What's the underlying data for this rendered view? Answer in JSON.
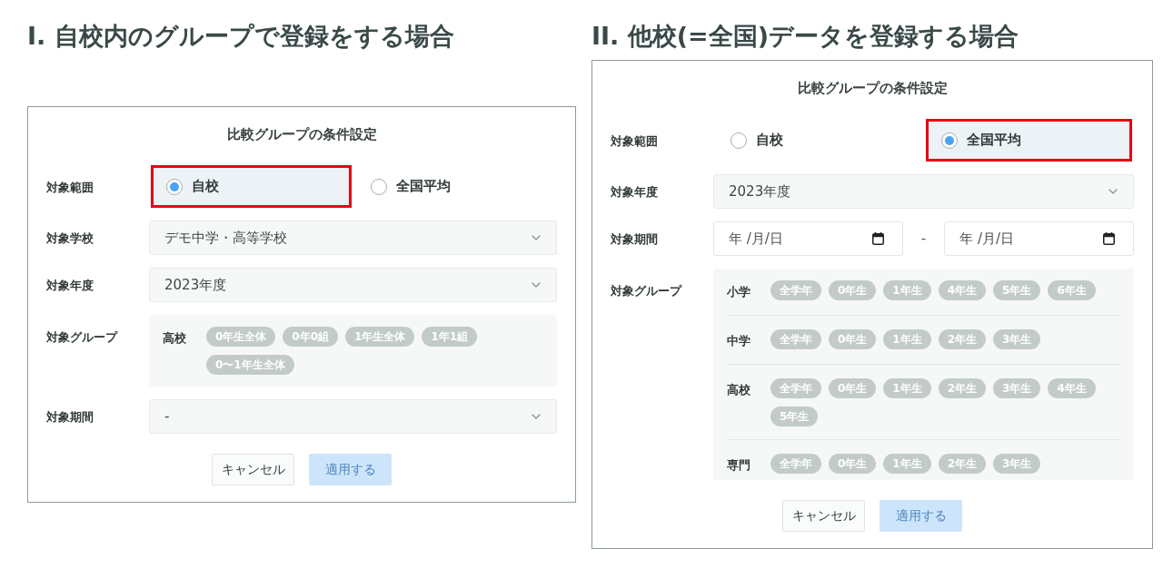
{
  "sections": [
    {
      "heading": "I. 自校内のグループで登録をする場合",
      "dialog": {
        "title": "比較グループの条件設定",
        "rows": [
          {
            "kind": "radio",
            "label": "対象範囲",
            "options": [
              {
                "label": "自校",
                "selected": true,
                "highlighted": true
              },
              {
                "label": "全国平均",
                "selected": false,
                "highlighted": false
              }
            ]
          },
          {
            "kind": "select",
            "label": "対象学校",
            "value": "デモ中学・高等学校"
          },
          {
            "kind": "select",
            "label": "対象年度",
            "value": "2023年度"
          },
          {
            "kind": "groups",
            "label": "対象グループ",
            "groups": [
              {
                "name": "高校",
                "chips": [
                  {
                    "label": "0年生全体",
                    "selected": false
                  },
                  {
                    "label": "0年0組",
                    "selected": false
                  },
                  {
                    "label": "1年生全体",
                    "selected": false
                  },
                  {
                    "label": "1年1組",
                    "selected": false
                  },
                  {
                    "label": "0〜1年生全体",
                    "selected": false
                  }
                ]
              }
            ]
          },
          {
            "kind": "select",
            "label": "対象期間",
            "value": "-"
          }
        ],
        "buttons": [
          {
            "kind": "secondary",
            "label": "キャンセル",
            "disabled": false
          },
          {
            "kind": "primary",
            "label": "適用する",
            "disabled": true
          }
        ]
      }
    },
    {
      "heading": "II. 他校(=全国)データを登録する場合",
      "dialog": {
        "title": "比較グループの条件設定",
        "rows": [
          {
            "kind": "radio",
            "label": "対象範囲",
            "options": [
              {
                "label": "自校",
                "selected": false,
                "highlighted": false
              },
              {
                "label": "全国平均",
                "selected": true,
                "highlighted": true
              }
            ]
          },
          {
            "kind": "select",
            "label": "対象年度",
            "value": "2023年度"
          },
          {
            "kind": "date_range",
            "label": "対象期間",
            "from": {
              "placeholder": "年 /月/日"
            },
            "separator": "-",
            "to": {
              "placeholder": "年 /月/日"
            }
          },
          {
            "kind": "groups",
            "label": "対象グループ",
            "groups": [
              {
                "name": "小学",
                "chips": [
                  {
                    "label": "全学年",
                    "selected": false
                  },
                  {
                    "label": "0年生",
                    "selected": false
                  },
                  {
                    "label": "1年生",
                    "selected": false
                  },
                  {
                    "label": "4年生",
                    "selected": false
                  },
                  {
                    "label": "5年生",
                    "selected": false
                  },
                  {
                    "label": "6年生",
                    "selected": false
                  }
                ]
              },
              {
                "name": "中学",
                "chips": [
                  {
                    "label": "全学年",
                    "selected": false
                  },
                  {
                    "label": "0年生",
                    "selected": false
                  },
                  {
                    "label": "1年生",
                    "selected": false
                  },
                  {
                    "label": "2年生",
                    "selected": false
                  },
                  {
                    "label": "3年生",
                    "selected": false
                  }
                ]
              },
              {
                "name": "高校",
                "chips": [
                  {
                    "label": "全学年",
                    "selected": false
                  },
                  {
                    "label": "0年生",
                    "selected": false
                  },
                  {
                    "label": "1年生",
                    "selected": false
                  },
                  {
                    "label": "2年生",
                    "selected": false
                  },
                  {
                    "label": "3年生",
                    "selected": false
                  },
                  {
                    "label": "4年生",
                    "selected": false
                  },
                  {
                    "label": "5年生",
                    "selected": false
                  }
                ]
              },
              {
                "name": "専門",
                "chips": [
                  {
                    "label": "全学年",
                    "selected": false
                  },
                  {
                    "label": "0年生",
                    "selected": false
                  },
                  {
                    "label": "1年生",
                    "selected": false
                  },
                  {
                    "label": "2年生",
                    "selected": false
                  },
                  {
                    "label": "3年生",
                    "selected": false
                  }
                ]
              }
            ]
          }
        ],
        "buttons": [
          {
            "kind": "secondary",
            "label": "キャンセル",
            "disabled": false
          },
          {
            "kind": "primary",
            "label": "適用する",
            "disabled": true
          }
        ]
      }
    }
  ]
}
